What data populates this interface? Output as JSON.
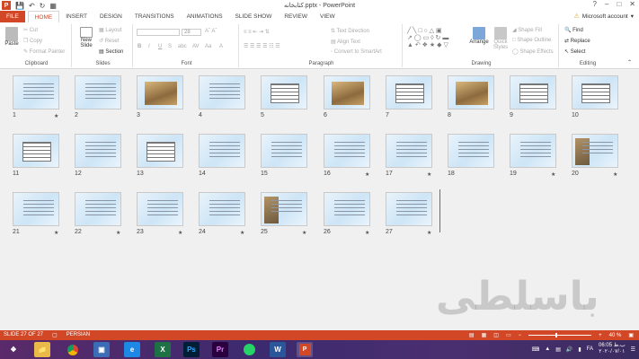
{
  "window": {
    "title": "کتابخانه.pptx - PowerPoint",
    "controls": [
      "?",
      "–",
      "□",
      "✕"
    ]
  },
  "tabs": [
    "FILE",
    "HOME",
    "INSERT",
    "DESIGN",
    "TRANSITIONS",
    "ANIMATIONS",
    "SLIDE SHOW",
    "REVIEW",
    "VIEW"
  ],
  "active_tab": "HOME",
  "account": "Microsoft account",
  "ribbon": {
    "clipboard": {
      "label": "Clipboard",
      "paste": "Paste",
      "cut": "Cut",
      "copy": "Copy",
      "format_painter": "Format Painter"
    },
    "slides": {
      "label": "Slides",
      "new_slide": "New Slide",
      "layout": "Layout",
      "reset": "Reset",
      "section": "Section"
    },
    "font": {
      "label": "Font",
      "size": "28"
    },
    "paragraph": {
      "label": "Paragraph",
      "text_direction": "Text Direction",
      "align_text": "Align Text",
      "smartart": "Convert to SmartArt"
    },
    "drawing": {
      "label": "Drawing",
      "arrange": "Arrange",
      "quick_styles": "Quick Styles",
      "shape_fill": "Shape Fill",
      "shape_outline": "Shape Outline",
      "shape_effects": "Shape Effects"
    },
    "editing": {
      "label": "Editing",
      "find": "Find",
      "replace": "Replace",
      "select": "Select"
    }
  },
  "slides": [
    {
      "n": "1",
      "kind": "text",
      "star": true
    },
    {
      "n": "2",
      "kind": "text",
      "star": false
    },
    {
      "n": "3",
      "kind": "photo",
      "star": false
    },
    {
      "n": "4",
      "kind": "text",
      "star": false
    },
    {
      "n": "5",
      "kind": "table",
      "star": false
    },
    {
      "n": "6",
      "kind": "photo",
      "star": false
    },
    {
      "n": "7",
      "kind": "table",
      "star": false
    },
    {
      "n": "8",
      "kind": "photo",
      "star": false
    },
    {
      "n": "9",
      "kind": "table",
      "star": false
    },
    {
      "n": "10",
      "kind": "table",
      "star": false
    },
    {
      "n": "11",
      "kind": "table",
      "star": false
    },
    {
      "n": "12",
      "kind": "text",
      "star": false
    },
    {
      "n": "13",
      "kind": "table",
      "star": false
    },
    {
      "n": "14",
      "kind": "text",
      "star": false
    },
    {
      "n": "15",
      "kind": "text",
      "star": false
    },
    {
      "n": "16",
      "kind": "text",
      "star": true
    },
    {
      "n": "17",
      "kind": "text",
      "star": true
    },
    {
      "n": "18",
      "kind": "text",
      "star": false
    },
    {
      "n": "19",
      "kind": "text",
      "star": true
    },
    {
      "n": "20",
      "kind": "side",
      "star": true
    },
    {
      "n": "21",
      "kind": "text",
      "star": true
    },
    {
      "n": "22",
      "kind": "text",
      "star": true
    },
    {
      "n": "23",
      "kind": "text",
      "star": true
    },
    {
      "n": "24",
      "kind": "text",
      "star": true
    },
    {
      "n": "25",
      "kind": "side",
      "star": true
    },
    {
      "n": "26",
      "kind": "text",
      "star": true
    },
    {
      "n": "27",
      "kind": "text",
      "star": true
    }
  ],
  "watermark": "باسلطی",
  "status": {
    "slide": "SLIDE 27 OF 27",
    "language": "PERSIAN",
    "zoom": "40 %"
  },
  "taskbar": {
    "apps": [
      "file-explorer",
      "chrome",
      "store",
      "ie",
      "excel",
      "photoshop",
      "premiere",
      "whatsapp",
      "word",
      "powerpoint"
    ],
    "lang": "FA",
    "time": "06:05 ب.ظ",
    "date": "۲۰۲۰/۰۷/۰۱"
  },
  "colors": {
    "accent": "#d24726"
  }
}
